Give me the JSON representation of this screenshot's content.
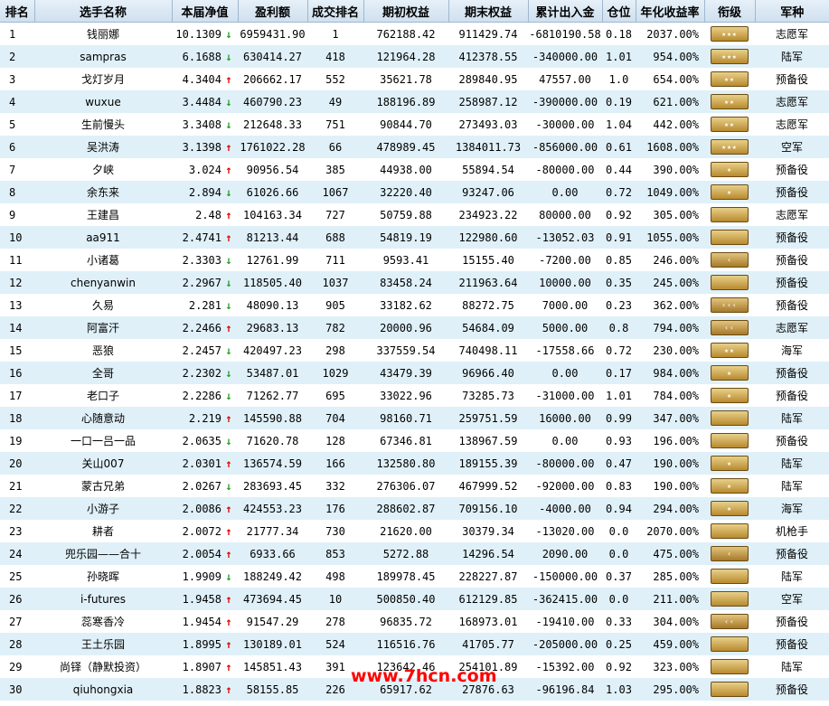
{
  "headers": [
    "排名",
    "选手名称",
    "本届净值",
    "盈利额",
    "成交排名",
    "期初权益",
    "期末权益",
    "累计出入金",
    "仓位",
    "年化收益率",
    "衔级",
    "军种"
  ],
  "watermark": "www.7hcn.com",
  "rows": [
    {
      "rank": "1",
      "name": "钱丽娜",
      "nav": "10.1309",
      "trend": "down",
      "profit": "6959431.90",
      "trade_rank": "1",
      "start": "762188.42",
      "end": "911429.74",
      "flow": "-6810190.58",
      "pos": "0.18",
      "annual": "2037.00%",
      "insignia": "star-badge",
      "insignia_text": "★★★",
      "branch": "志愿军"
    },
    {
      "rank": "2",
      "name": "sampras",
      "nav": "6.1688",
      "trend": "down",
      "profit": "630414.27",
      "trade_rank": "418",
      "start": "121964.28",
      "end": "412378.55",
      "flow": "-340000.00",
      "pos": "1.01",
      "annual": "954.00%",
      "insignia": "star-badge",
      "insignia_text": "★★★",
      "branch": "陆军"
    },
    {
      "rank": "3",
      "name": "戈灯岁月",
      "nav": "4.3404",
      "trend": "up",
      "profit": "206662.17",
      "trade_rank": "552",
      "start": "35621.78",
      "end": "289840.95",
      "flow": "47557.00",
      "pos": "1.0",
      "annual": "654.00%",
      "insignia": "star-badge",
      "insignia_text": "★★",
      "branch": "预备役"
    },
    {
      "rank": "4",
      "name": "wuxue",
      "nav": "3.4484",
      "trend": "down",
      "profit": "460790.23",
      "trade_rank": "49",
      "start": "188196.89",
      "end": "258987.12",
      "flow": "-390000.00",
      "pos": "0.19",
      "annual": "621.00%",
      "insignia": "star-badge",
      "insignia_text": "★★",
      "branch": "志愿军"
    },
    {
      "rank": "5",
      "name": "生前慢头",
      "nav": "3.3408",
      "trend": "down",
      "profit": "212648.33",
      "trade_rank": "751",
      "start": "90844.70",
      "end": "273493.03",
      "flow": "-30000.00",
      "pos": "1.04",
      "annual": "442.00%",
      "insignia": "star-badge",
      "insignia_text": "★★",
      "branch": "志愿军"
    },
    {
      "rank": "6",
      "name": "吴洪涛",
      "nav": "3.1398",
      "trend": "up",
      "profit": "1761022.28",
      "trade_rank": "66",
      "start": "478989.45",
      "end": "1384011.73",
      "flow": "-856000.00",
      "pos": "0.61",
      "annual": "1608.00%",
      "insignia": "star-badge",
      "insignia_text": "★★★",
      "branch": "空军"
    },
    {
      "rank": "7",
      "name": "夕峡",
      "nav": "3.024",
      "trend": "up",
      "profit": "90956.54",
      "trade_rank": "385",
      "start": "44938.00",
      "end": "55894.54",
      "flow": "-80000.00",
      "pos": "0.44",
      "annual": "390.00%",
      "insignia": "star-badge",
      "insignia_text": "★",
      "branch": "预备役"
    },
    {
      "rank": "8",
      "name": "余东来",
      "nav": "2.894",
      "trend": "down",
      "profit": "61026.66",
      "trade_rank": "1067",
      "start": "32220.40",
      "end": "93247.06",
      "flow": "0.00",
      "pos": "0.72",
      "annual": "1049.00%",
      "insignia": "star-badge",
      "insignia_text": "★",
      "branch": "预备役"
    },
    {
      "rank": "9",
      "name": "王建昌",
      "nav": "2.48",
      "trend": "up",
      "profit": "104163.34",
      "trade_rank": "727",
      "start": "50759.88",
      "end": "234923.22",
      "flow": "80000.00",
      "pos": "0.92",
      "annual": "305.00%",
      "insignia": "star-badge",
      "insignia_text": "",
      "branch": "志愿军"
    },
    {
      "rank": "10",
      "name": "aa911",
      "nav": "2.4741",
      "trend": "up",
      "profit": "81213.44",
      "trade_rank": "688",
      "start": "54819.19",
      "end": "122980.60",
      "flow": "-13052.03",
      "pos": "0.91",
      "annual": "1055.00%",
      "insignia": "star-badge",
      "insignia_text": "",
      "branch": "预备役"
    },
    {
      "rank": "11",
      "name": "小诸葛",
      "nav": "2.3303",
      "trend": "down",
      "profit": "12761.99",
      "trade_rank": "711",
      "start": "9593.41",
      "end": "15155.40",
      "flow": "-7200.00",
      "pos": "0.85",
      "annual": "246.00%",
      "insignia": "chevron-badge",
      "insignia_text": "‹",
      "branch": "预备役"
    },
    {
      "rank": "12",
      "name": "chenyanwin",
      "nav": "2.2967",
      "trend": "down",
      "profit": "118505.40",
      "trade_rank": "1037",
      "start": "83458.24",
      "end": "211963.64",
      "flow": "10000.00",
      "pos": "0.35",
      "annual": "245.00%",
      "insignia": "star-badge",
      "insignia_text": "",
      "branch": "预备役"
    },
    {
      "rank": "13",
      "name": "久易",
      "nav": "2.281",
      "trend": "down",
      "profit": "48090.13",
      "trade_rank": "905",
      "start": "33182.62",
      "end": "88272.75",
      "flow": "7000.00",
      "pos": "0.23",
      "annual": "362.00%",
      "insignia": "chevron-badge",
      "insignia_text": "‹‹‹",
      "branch": "预备役"
    },
    {
      "rank": "14",
      "name": "阿富汗",
      "nav": "2.2466",
      "trend": "up",
      "profit": "29683.13",
      "trade_rank": "782",
      "start": "20000.96",
      "end": "54684.09",
      "flow": "5000.00",
      "pos": "0.8",
      "annual": "794.00%",
      "insignia": "chevron-badge",
      "insignia_text": "‹‹",
      "branch": "志愿军"
    },
    {
      "rank": "15",
      "name": "恶狼",
      "nav": "2.2457",
      "trend": "down",
      "profit": "420497.23",
      "trade_rank": "298",
      "start": "337559.54",
      "end": "740498.11",
      "flow": "-17558.66",
      "pos": "0.72",
      "annual": "230.00%",
      "insignia": "star-badge",
      "insignia_text": "★★",
      "branch": "海军"
    },
    {
      "rank": "16",
      "name": "全哥",
      "nav": "2.2302",
      "trend": "down",
      "profit": "53487.01",
      "trade_rank": "1029",
      "start": "43479.39",
      "end": "96966.40",
      "flow": "0.00",
      "pos": "0.17",
      "annual": "984.00%",
      "insignia": "star-badge",
      "insignia_text": "★",
      "branch": "预备役"
    },
    {
      "rank": "17",
      "name": "老口子",
      "nav": "2.2286",
      "trend": "down",
      "profit": "71262.77",
      "trade_rank": "695",
      "start": "33022.96",
      "end": "73285.73",
      "flow": "-31000.00",
      "pos": "1.01",
      "annual": "784.00%",
      "insignia": "star-badge",
      "insignia_text": "★",
      "branch": "预备役"
    },
    {
      "rank": "18",
      "name": "心随意动",
      "nav": "2.219",
      "trend": "up",
      "profit": "145590.88",
      "trade_rank": "704",
      "start": "98160.71",
      "end": "259751.59",
      "flow": "16000.00",
      "pos": "0.99",
      "annual": "347.00%",
      "insignia": "star-badge",
      "insignia_text": "",
      "branch": "陆军"
    },
    {
      "rank": "19",
      "name": "一口一吕一品",
      "nav": "2.0635",
      "trend": "down",
      "profit": "71620.78",
      "trade_rank": "128",
      "start": "67346.81",
      "end": "138967.59",
      "flow": "0.00",
      "pos": "0.93",
      "annual": "196.00%",
      "insignia": "star-badge",
      "insignia_text": "",
      "branch": "预备役"
    },
    {
      "rank": "20",
      "name": "关山007",
      "nav": "2.0301",
      "trend": "up",
      "profit": "136574.59",
      "trade_rank": "166",
      "start": "132580.80",
      "end": "189155.39",
      "flow": "-80000.00",
      "pos": "0.47",
      "annual": "190.00%",
      "insignia": "star-badge",
      "insignia_text": "★",
      "branch": "陆军"
    },
    {
      "rank": "21",
      "name": "蒙古兄弟",
      "nav": "2.0267",
      "trend": "down",
      "profit": "283693.45",
      "trade_rank": "332",
      "start": "276306.07",
      "end": "467999.52",
      "flow": "-92000.00",
      "pos": "0.83",
      "annual": "190.00%",
      "insignia": "star-badge",
      "insignia_text": "★",
      "branch": "陆军"
    },
    {
      "rank": "22",
      "name": "小游子",
      "nav": "2.0086",
      "trend": "up",
      "profit": "424553.23",
      "trade_rank": "176",
      "start": "288602.87",
      "end": "709156.10",
      "flow": "-4000.00",
      "pos": "0.94",
      "annual": "294.00%",
      "insignia": "star-badge",
      "insignia_text": "★",
      "branch": "海军"
    },
    {
      "rank": "23",
      "name": "耕者",
      "nav": "2.0072",
      "trend": "up",
      "profit": "21777.34",
      "trade_rank": "730",
      "start": "21620.00",
      "end": "30379.34",
      "flow": "-13020.00",
      "pos": "0.0",
      "annual": "2070.00%",
      "insignia": "star-badge",
      "insignia_text": "",
      "branch": "机枪手"
    },
    {
      "rank": "24",
      "name": "兜乐园——合十",
      "nav": "2.0054",
      "trend": "up",
      "profit": "6933.66",
      "trade_rank": "853",
      "start": "5272.88",
      "end": "14296.54",
      "flow": "2090.00",
      "pos": "0.0",
      "annual": "475.00%",
      "insignia": "chevron-badge",
      "insignia_text": "‹",
      "branch": "预备役"
    },
    {
      "rank": "25",
      "name": "孙晓晖",
      "nav": "1.9909",
      "trend": "down",
      "profit": "188249.42",
      "trade_rank": "498",
      "start": "189978.45",
      "end": "228227.87",
      "flow": "-150000.00",
      "pos": "0.37",
      "annual": "285.00%",
      "insignia": "star-badge",
      "insignia_text": "",
      "branch": "陆军"
    },
    {
      "rank": "26",
      "name": "i-futures",
      "nav": "1.9458",
      "trend": "up",
      "profit": "473694.45",
      "trade_rank": "10",
      "start": "500850.40",
      "end": "612129.85",
      "flow": "-362415.00",
      "pos": "0.0",
      "annual": "211.00%",
      "insignia": "star-badge",
      "insignia_text": "",
      "branch": "空军"
    },
    {
      "rank": "27",
      "name": "蕊寒香冷",
      "nav": "1.9454",
      "trend": "up",
      "profit": "91547.29",
      "trade_rank": "278",
      "start": "96835.72",
      "end": "168973.01",
      "flow": "-19410.00",
      "pos": "0.33",
      "annual": "304.00%",
      "insignia": "chevron-badge",
      "insignia_text": "‹‹",
      "branch": "预备役"
    },
    {
      "rank": "28",
      "name": "王土乐园",
      "nav": "1.8995",
      "trend": "up",
      "profit": "130189.01",
      "trade_rank": "524",
      "start": "116516.76",
      "end": "41705.77",
      "flow": "-205000.00",
      "pos": "0.25",
      "annual": "459.00%",
      "insignia": "star-badge",
      "insignia_text": "",
      "branch": "预备役"
    },
    {
      "rank": "29",
      "name": "尚铎（静默投资）",
      "nav": "1.8907",
      "trend": "up",
      "profit": "145851.43",
      "trade_rank": "391",
      "start": "123642.46",
      "end": "254101.89",
      "flow": "-15392.00",
      "pos": "0.92",
      "annual": "323.00%",
      "insignia": "star-badge",
      "insignia_text": "",
      "branch": "陆军"
    },
    {
      "rank": "30",
      "name": "qiuhongxia",
      "nav": "1.8823",
      "trend": "up",
      "profit": "58155.85",
      "trade_rank": "226",
      "start": "65917.62",
      "end": "27876.63",
      "flow": "-96196.84",
      "pos": "1.03",
      "annual": "295.00%",
      "insignia": "star-badge",
      "insignia_text": "",
      "branch": "预备役"
    }
  ]
}
